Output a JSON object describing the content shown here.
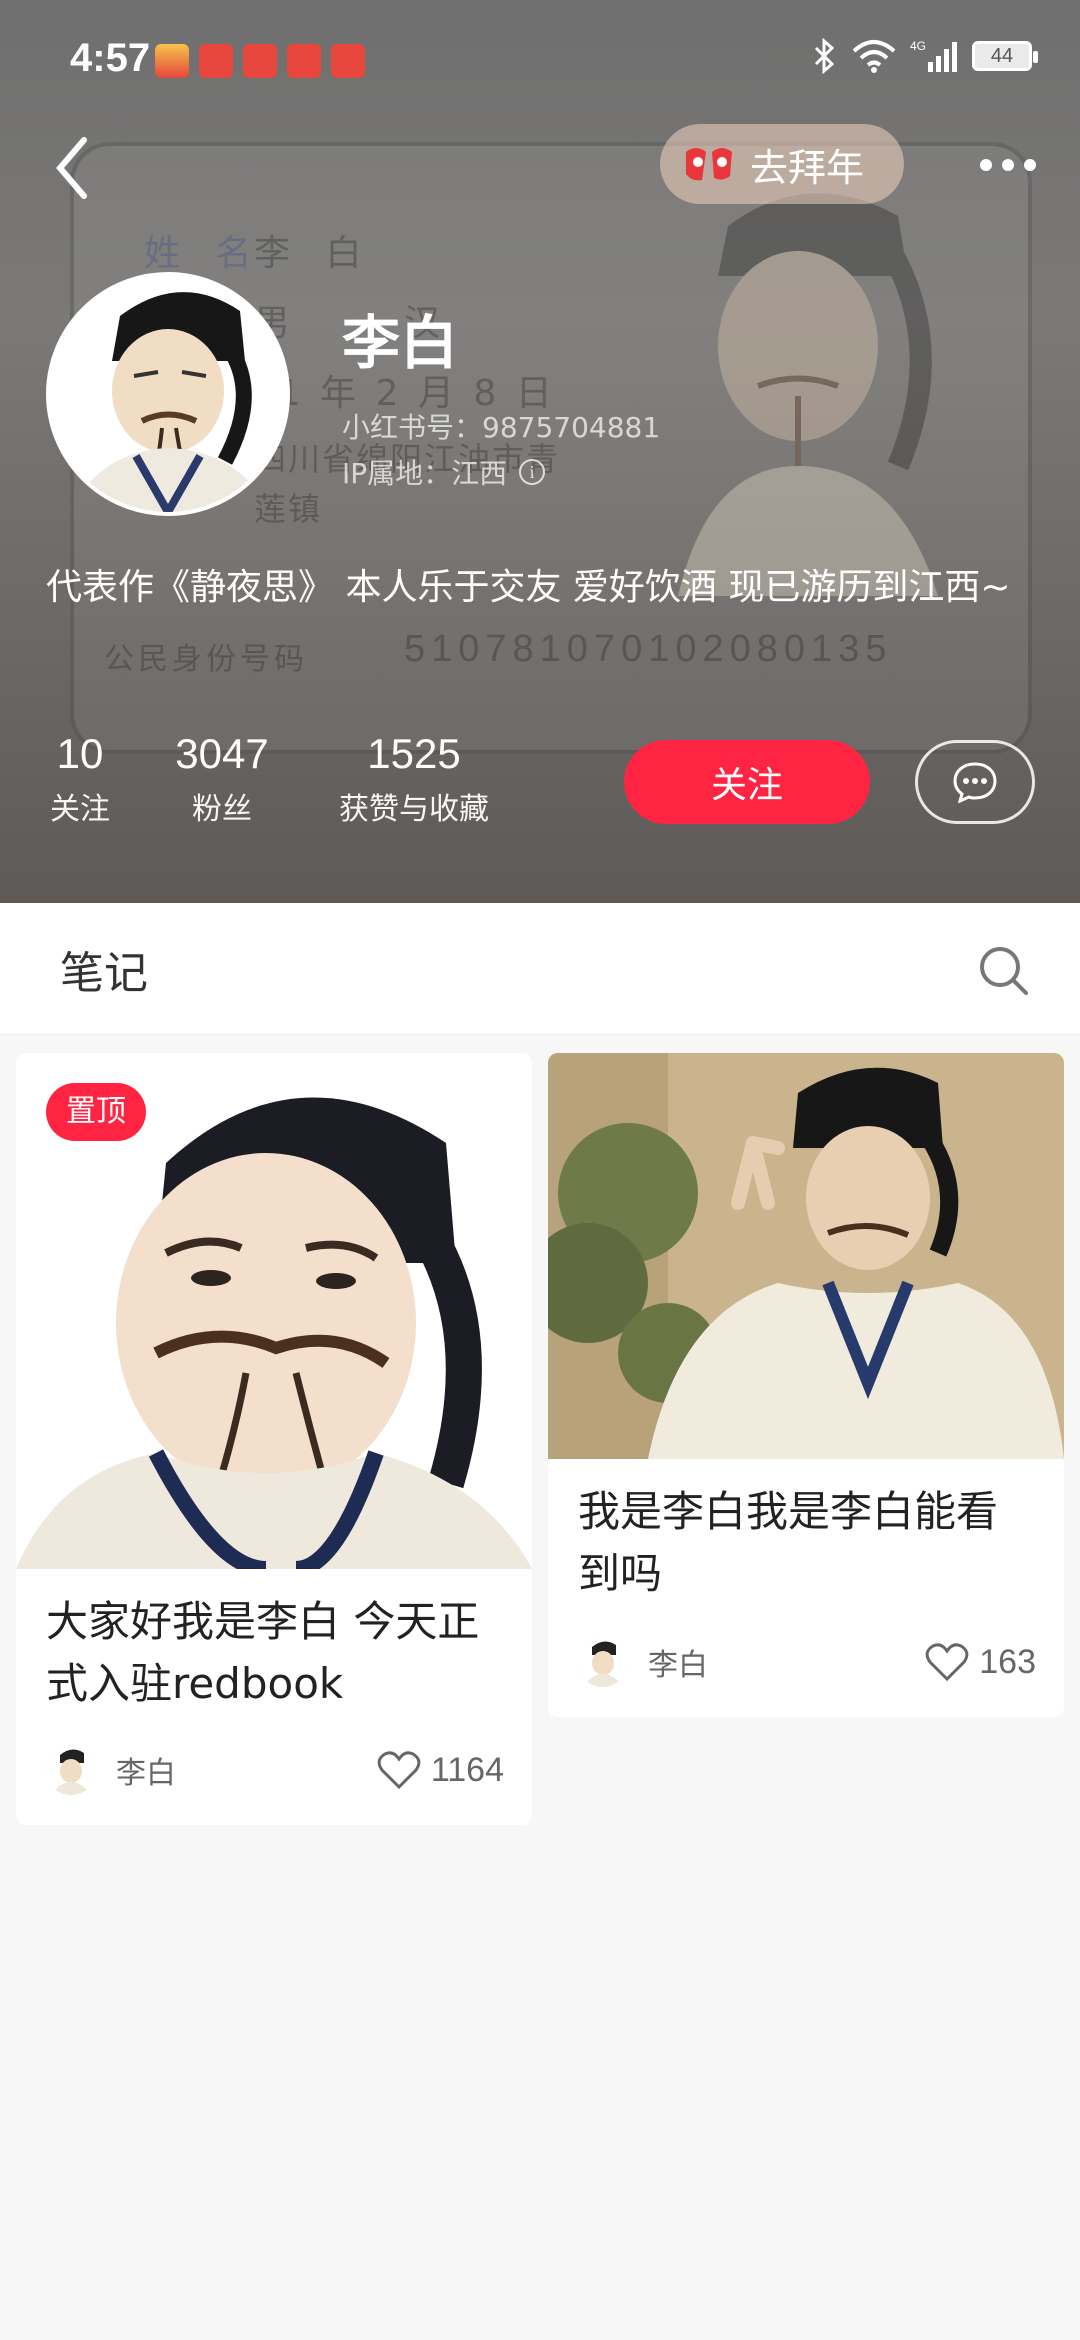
{
  "status_bar": {
    "time": "4:57",
    "battery": "44"
  },
  "header": {
    "new_year_label": "去拜年"
  },
  "backdrop_card": {
    "name_label": "姓 名",
    "name_value": "李 白",
    "line_sex": "男",
    "line_ethnic": "汉",
    "line_birth": "701 年 2 月 8 日",
    "line_address": "四川省绵阳江油市青",
    "line_address2": "莲镇",
    "id_label": "公民身份号码",
    "id_number": "510781070102080135"
  },
  "profile": {
    "name": "李白",
    "red_id": "小红书号：9875704881",
    "ip_location": "IP属地：江西",
    "bio": "代表作《静夜思》 本人乐于交友 爱好饮酒 现已游历到江西~"
  },
  "stats": {
    "following": {
      "value": "10",
      "label": "关注"
    },
    "fans": {
      "value": "3047",
      "label": "粉丝"
    },
    "likes": {
      "value": "1525",
      "label": "获赞与收藏"
    }
  },
  "actions": {
    "follow": "关注"
  },
  "tabs": {
    "notes": "笔记"
  },
  "notes": [
    {
      "pinned_label": "置顶",
      "title": "大家好我是李白 今天正式入驻redbook",
      "author": "李白",
      "likes": "1164"
    },
    {
      "title": "我是李白我是李白能看到吗",
      "author": "李白",
      "likes": "163"
    }
  ],
  "colors": {
    "accent": "#ff2442",
    "header_bg": "#6f6f6f",
    "feed_bg": "#f7f7f7"
  }
}
